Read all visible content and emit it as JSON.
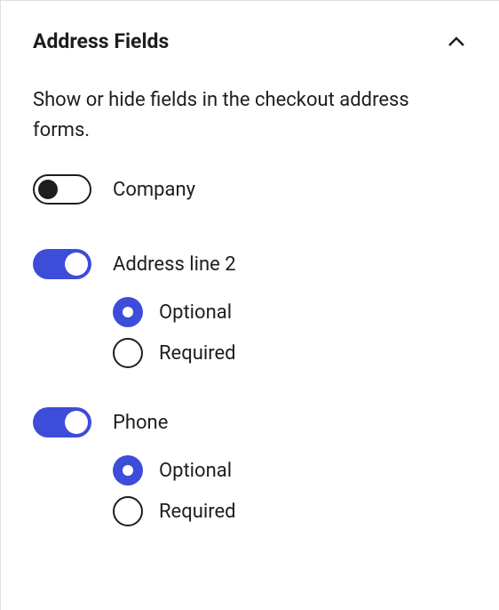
{
  "panel": {
    "title": "Address Fields",
    "description": "Show or hide fields in the checkout address forms."
  },
  "fields": {
    "company": {
      "label": "Company",
      "enabled": false
    },
    "address2": {
      "label": "Address line 2",
      "enabled": true,
      "options": {
        "optional": "Optional",
        "required": "Required",
        "selected": "optional"
      }
    },
    "phone": {
      "label": "Phone",
      "enabled": true,
      "options": {
        "optional": "Optional",
        "required": "Required",
        "selected": "optional"
      }
    }
  },
  "colors": {
    "accent": "#3d4cd9",
    "text": "#1e1e1e"
  }
}
